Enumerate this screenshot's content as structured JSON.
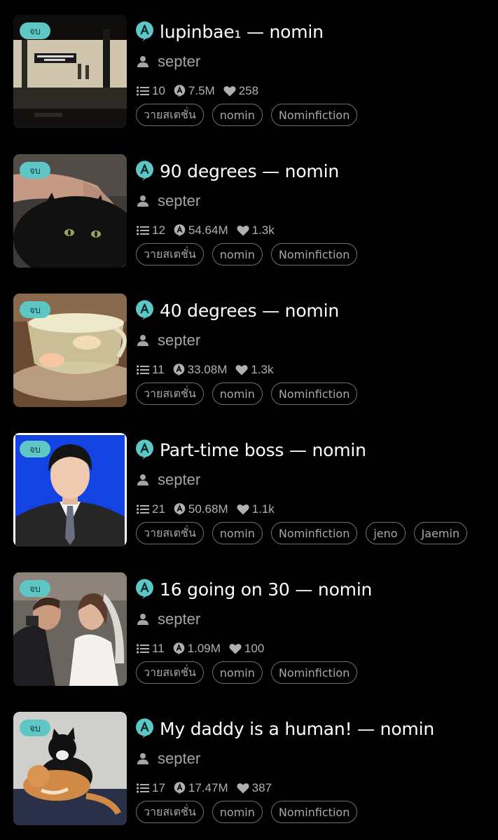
{
  "stories": [
    {
      "status": "จบ",
      "title": "lupinbae₁ — nomin",
      "author": "septer",
      "chapters": "10",
      "views": "7.5M",
      "likes": "258",
      "tags": [
        "วายสเตชั่น",
        "nomin",
        "Nominfiction"
      ],
      "cover_icon": "subway-station-photo"
    },
    {
      "status": "จบ",
      "title": "90 degrees — nomin",
      "author": "septer",
      "chapters": "12",
      "views": "54.64M",
      "likes": "1.3k",
      "tags": [
        "วายสเตชั่น",
        "nomin",
        "Nominfiction"
      ],
      "cover_icon": "black-cat-photo"
    },
    {
      "status": "จบ",
      "title": "40 degrees — nomin",
      "author": "septer",
      "chapters": "11",
      "views": "33.08M",
      "likes": "1.3k",
      "tags": [
        "วายสเตชั่น",
        "nomin",
        "Nominfiction"
      ],
      "cover_icon": "teacup-goldfish-photo"
    },
    {
      "status": "จบ",
      "title": "Part-time boss — nomin",
      "author": "septer",
      "chapters": "21",
      "views": "50.68M",
      "likes": "1.1k",
      "tags": [
        "วายสเตชั่น",
        "nomin",
        "Nominfiction",
        "jeno",
        "Jaemin"
      ],
      "cover_icon": "id-portrait-photo"
    },
    {
      "status": "จบ",
      "title": "16 going on 30 — nomin",
      "author": "septer",
      "chapters": "11",
      "views": "1.09M",
      "likes": "100",
      "tags": [
        "วายสเตชั่น",
        "nomin",
        "Nominfiction"
      ],
      "cover_icon": "wedding-photo"
    },
    {
      "status": "จบ",
      "title": "My daddy is a human! — nomin",
      "author": "septer",
      "chapters": "17",
      "views": "17.47M",
      "likes": "387",
      "tags": [
        "วายสเตชั่น",
        "nomin",
        "Nominfiction"
      ],
      "cover_icon": "two-cats-photo"
    }
  ],
  "colors": {
    "badge": "#5ec7c6",
    "background": "#000000",
    "title": "#ffffff",
    "meta": "#a4a4a4",
    "tag_border": "#707070"
  }
}
